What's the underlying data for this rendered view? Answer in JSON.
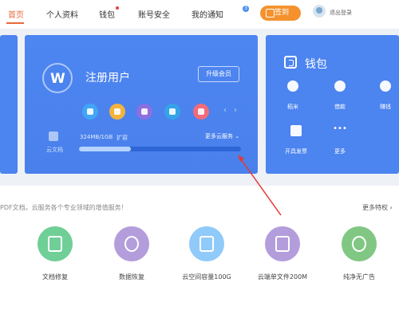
{
  "nav": {
    "home": "首页",
    "profile": "个人资料",
    "wallet": "钱包",
    "security": "账号安全",
    "notifications": "我的通知",
    "notification_count": "3",
    "signin": "签到",
    "logout": "退出登录"
  },
  "user_card": {
    "user_type": "注册用户",
    "upgrade": "升级会员",
    "cloud_label": "云文档",
    "storage": "324MB/1GB",
    "expand": "扩容",
    "more_services": "更多云服务",
    "storage_used_fraction": 0.32,
    "carousel_prev": "‹",
    "carousel_next": "›",
    "service_icon_colors": [
      "#42a5f5",
      "#f2b33d",
      "#8c6fe0",
      "#36a3e8",
      "#f06b7a"
    ]
  },
  "wallet_card": {
    "title": "钱包",
    "items": [
      {
        "label": "稻米",
        "icon": "rice-icon"
      },
      {
        "label": "借款",
        "icon": "loan-icon"
      },
      {
        "label": "赚钱",
        "icon": "earn-icon"
      },
      {
        "label": "开具发票",
        "icon": "invoice-icon"
      },
      {
        "label": "更多",
        "icon": "more-icon"
      }
    ]
  },
  "services": {
    "description": "PDF文档。云服务各个专业领域的增值服务！",
    "more_privileges": "更多特权",
    "tiles": [
      {
        "label": "文档修复",
        "color": "#6fcf97",
        "icon": "repair-icon"
      },
      {
        "label": "数据恢复",
        "color": "#b39ddb",
        "icon": "recover-icon"
      },
      {
        "label": "云空间容量100G",
        "color": "#90caf9",
        "icon": "storage-icon"
      },
      {
        "label": "云端单文件200M",
        "color": "#b39ddb",
        "icon": "file-icon"
      },
      {
        "label": "纯净无广告",
        "color": "#81c784",
        "icon": "no-ad-icon"
      }
    ]
  },
  "colors": {
    "accent": "#e9693a",
    "card_blue": "#4c84f0",
    "signin": "#f5922e",
    "annotation": "#e53935"
  }
}
